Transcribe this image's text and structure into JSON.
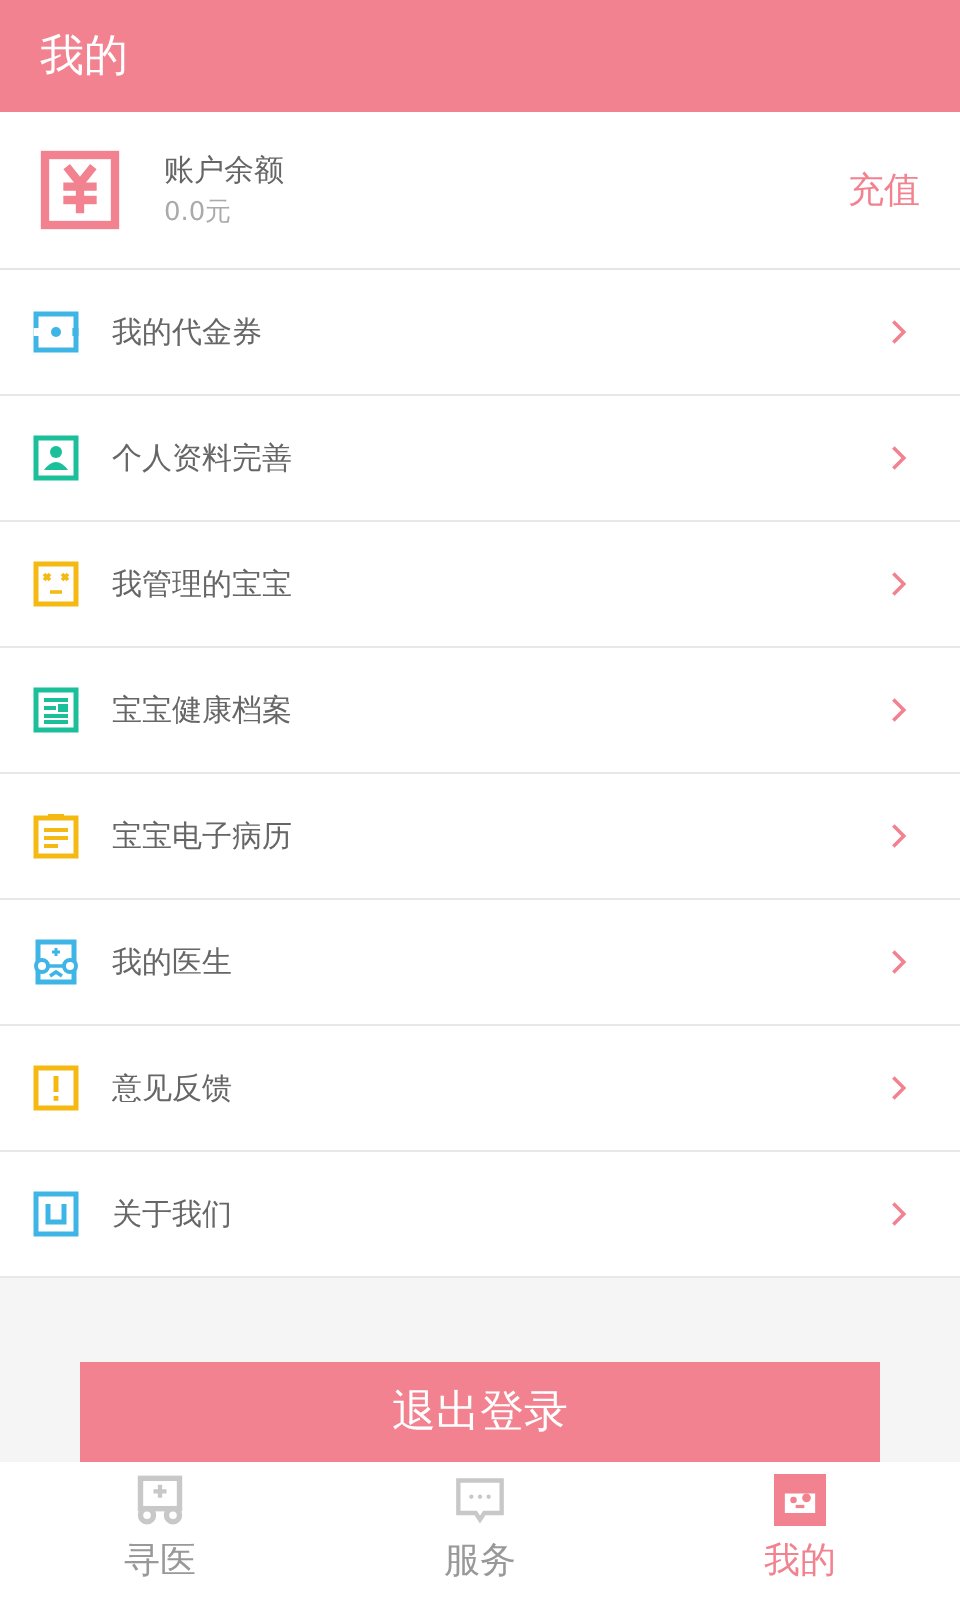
{
  "header": {
    "title": "我的"
  },
  "balance": {
    "label": "账户余额",
    "amount": "0.0元",
    "action": "充值"
  },
  "menu": [
    {
      "kind": "voucher",
      "label": "我的代金券",
      "color": "#3eb5e5"
    },
    {
      "kind": "profile",
      "label": "个人资料完善",
      "color": "#1bbf9a"
    },
    {
      "kind": "baby",
      "label": "我管理的宝宝",
      "color": "#f5b914"
    },
    {
      "kind": "record",
      "label": "宝宝健康档案",
      "color": "#1bbf9a"
    },
    {
      "kind": "clipboard",
      "label": "宝宝电子病历",
      "color": "#f5b914"
    },
    {
      "kind": "doctor",
      "label": "我的医生",
      "color": "#3eb5e5"
    },
    {
      "kind": "feedback",
      "label": "意见反馈",
      "color": "#f5b914"
    },
    {
      "kind": "about",
      "label": "关于我们",
      "color": "#3eb5e5"
    }
  ],
  "logout": "退出登录",
  "tabs": [
    {
      "kind": "find",
      "label": "寻医",
      "selected": false
    },
    {
      "kind": "service",
      "label": "服务",
      "selected": false
    },
    {
      "kind": "me",
      "label": "我的",
      "selected": true
    }
  ]
}
